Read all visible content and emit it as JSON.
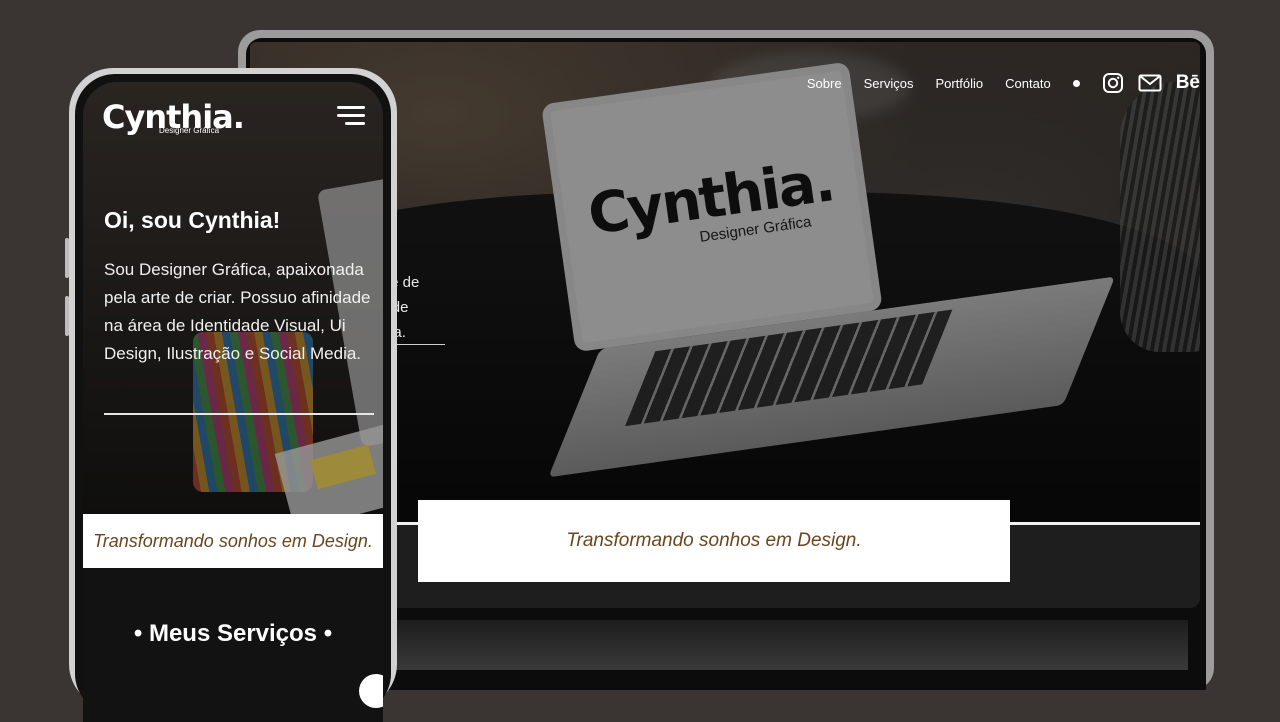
{
  "laptop": {
    "nav": {
      "items": [
        "Sobre",
        "Serviços",
        "Portfólio",
        "Contato"
      ],
      "icons": [
        "instagram-icon",
        "mail-icon"
      ],
      "behance": "Bē"
    },
    "intro_lines": [
      ", apaixonada pela arte de",
      "e na área de Identidade",
      "stração e Social Media."
    ],
    "mock_logo": "Cynthia.",
    "mock_logo_sub": "Designer Gráfica",
    "tagline": "Transformando sonhos em Design."
  },
  "phone": {
    "logo": "Cynthia.",
    "logo_sub": "Designer Gráfica",
    "title": "Oi, sou Cynthia!",
    "intro": "Sou Designer Gráfica, apaixonada pela arte de criar. Possuo afinidade na área de Identidade Visual, Ui Design, Ilustração e Social Media.",
    "tagline": "Transformando sonhos em Design.",
    "services_heading": "• Meus Serviços •"
  },
  "colors": {
    "background": "#3a3532",
    "tagline_text": "#6a4520",
    "white": "#ffffff"
  }
}
